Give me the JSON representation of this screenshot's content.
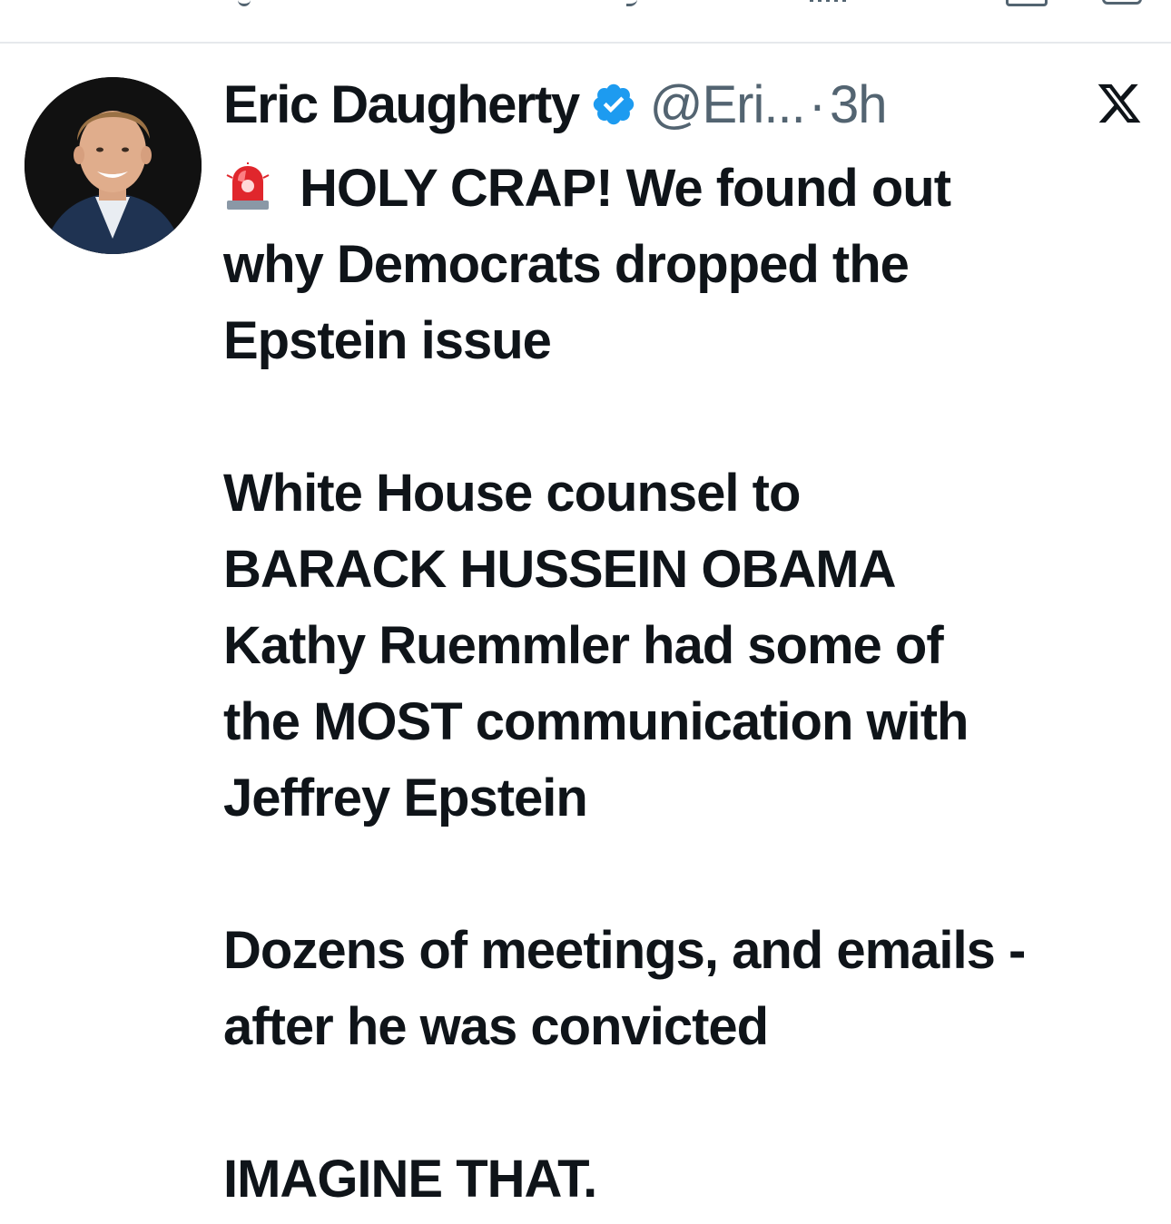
{
  "top_bar": {
    "icons": [
      "reply-icon",
      "repost-icon",
      "views-icon",
      "bookmark-icon",
      "share-icon"
    ]
  },
  "tweet": {
    "author_name": "Eric Daugherty",
    "verified": true,
    "handle": "@Eri...",
    "separator": "·",
    "time": "3h",
    "platform_icon": "x-logo-icon",
    "siren_icon": "police-light-emoji",
    "lines": {
      "p1": [
        "HOLY CRAP! We found out",
        "why Democrats dropped the",
        "Epstein issue"
      ],
      "p2": [
        "White House counsel to",
        "BARACK HUSSEIN OBAMA",
        "Kathy Ruemmler had some of",
        "the MOST communication with",
        "Jeffrey Epstein"
      ],
      "p3": [
        "Dozens of meetings, and emails -",
        "after he was convicted"
      ],
      "p4": [
        "IMAGINE THAT."
      ]
    }
  },
  "colors": {
    "text": "#0f1419",
    "secondary": "#536471",
    "verified_blue": "#1d9bf0",
    "divider": "#e6e9ec"
  }
}
